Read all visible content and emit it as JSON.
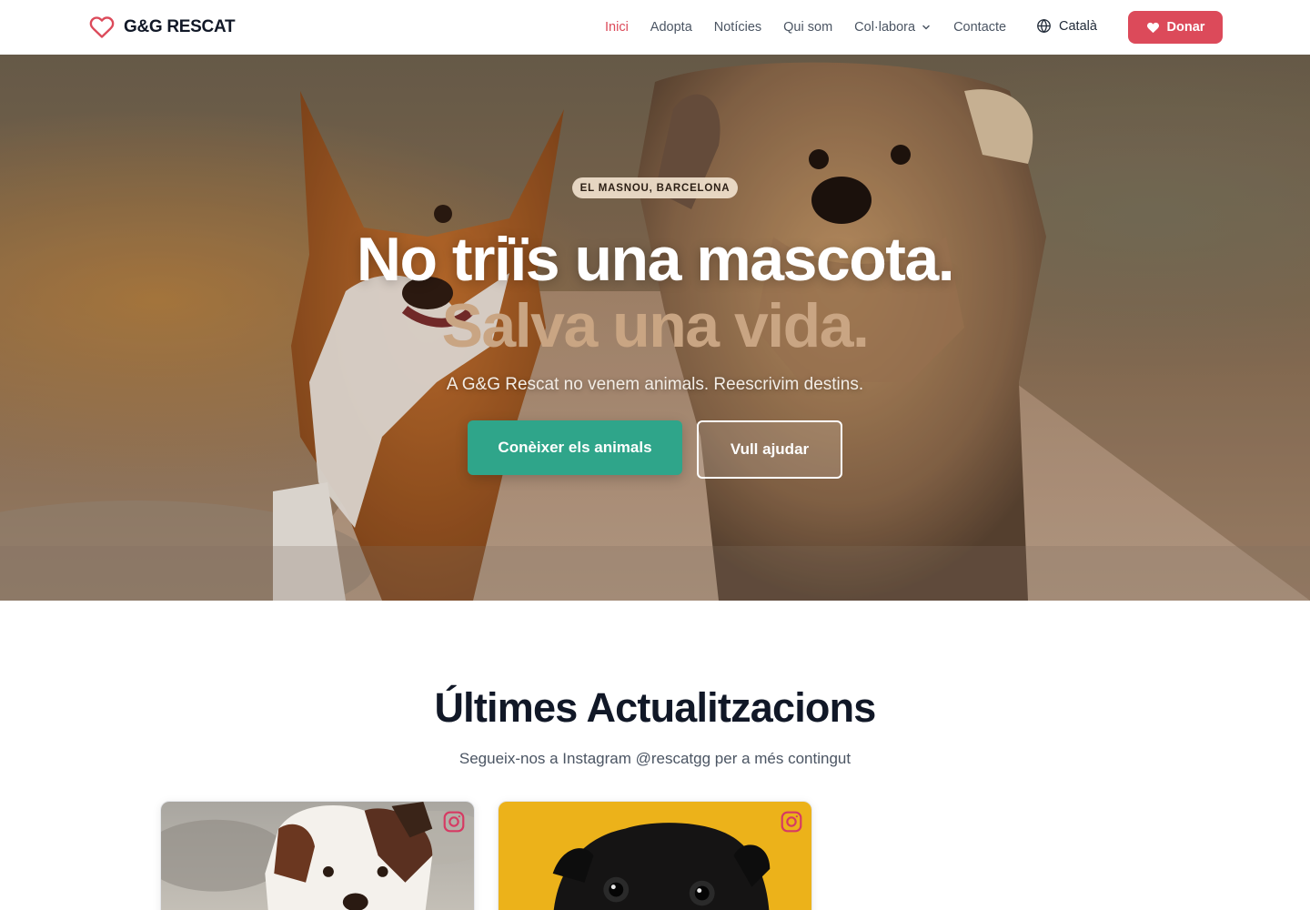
{
  "brand": {
    "name": "G&G RESCAT",
    "icon": "heart-outline-icon"
  },
  "nav": {
    "items": [
      {
        "label": "Inici",
        "active": true
      },
      {
        "label": "Adopta"
      },
      {
        "label": "Notícies"
      },
      {
        "label": "Qui som"
      },
      {
        "label": "Col·labora",
        "has_dropdown": true
      },
      {
        "label": "Contacte"
      }
    ],
    "language": "Català",
    "donate_label": "Donar"
  },
  "hero": {
    "badge": "EL MASNOU, BARCELONA",
    "title_line1": "No triïs una mascota.",
    "title_line2": "Salva una vida.",
    "subtitle": "A G&G Rescat no venem animals. Reescrivim destins.",
    "primary_button": "Conèixer els animals",
    "secondary_button": "Vull ajudar"
  },
  "updates": {
    "title": "Últimes Actualitzacions",
    "subtitle": "Segueix-nos a Instagram @rescatgg per a més contingut",
    "cards": [
      {
        "image": "dog-photo",
        "source_icon": "instagram-icon"
      },
      {
        "image": "pug-photo",
        "source_icon": "instagram-icon"
      }
    ]
  },
  "colors": {
    "accent_red": "#dc4a5a",
    "primary_green": "#2fa58a",
    "hero_tan": "#c9a583",
    "text_dark": "#111827"
  }
}
